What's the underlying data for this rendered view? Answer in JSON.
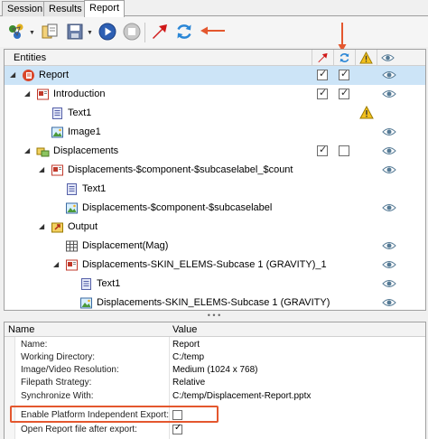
{
  "tabs": [
    {
      "label": "Session",
      "active": false
    },
    {
      "label": "Results",
      "active": false
    },
    {
      "label": "Report",
      "active": true
    }
  ],
  "toolbar": {
    "icons": [
      "add-entities-icon",
      "copy-icon",
      "save-icon",
      "play-icon",
      "stop-icon",
      "export-icon",
      "refresh-icon"
    ]
  },
  "tree": {
    "header": "Entities",
    "columns": [
      "export-icon",
      "refresh-icon",
      "warning-icon",
      "eye-icon"
    ],
    "rows": [
      {
        "label": "Report",
        "icon": "report-icon",
        "col1": true,
        "col2": true,
        "eye": true,
        "selected": true
      },
      {
        "label": "Introduction",
        "icon": "chapter-icon",
        "col1": true,
        "col2": true,
        "eye": true
      },
      {
        "label": "Text1",
        "icon": "text-icon",
        "warning": true
      },
      {
        "label": "Image1",
        "icon": "image-icon",
        "eye": true
      },
      {
        "label": "Displacements",
        "icon": "chapter-group-icon",
        "col1": true,
        "col2": false,
        "eye": true
      },
      {
        "label": "Displacements-$component-$subcaselabel_$count",
        "icon": "chapter-icon",
        "eye": true
      },
      {
        "label": "Text1",
        "icon": "text-icon"
      },
      {
        "label": "Displacements-$component-$subcaselabel",
        "icon": "image-icon",
        "eye": true
      },
      {
        "label": "Output",
        "icon": "output-icon"
      },
      {
        "label": "Displacement(Mag)",
        "icon": "table-icon",
        "eye": true
      },
      {
        "label": "Displacements-SKIN_ELEMS-Subcase 1 (GRAVITY)_1",
        "icon": "chapter-icon",
        "eye": true
      },
      {
        "label": "Text1",
        "icon": "text-icon",
        "eye": true
      },
      {
        "label": "Displacements-SKIN_ELEMS-Subcase 1 (GRAVITY)",
        "icon": "image-icon",
        "eye": true
      }
    ]
  },
  "splitter": "• • •",
  "properties": {
    "name_header": "Name",
    "value_header": "Value",
    "rows": [
      {
        "name": "Name:",
        "value": "Report"
      },
      {
        "name": "Working Directory:",
        "value": "C:/temp"
      },
      {
        "name": "Image/Video Resolution:",
        "value": "Medium (1024 x 768)"
      },
      {
        "name": "Filepath Strategy:",
        "value": "Relative"
      },
      {
        "name": "Synchronize With:",
        "value": "C:/temp/Displacement-Report.pptx"
      },
      {
        "name": "Enable Platform Independent Export:",
        "checkbox": false
      },
      {
        "name": "Open Report file after export:",
        "checkbox": true
      }
    ]
  },
  "colors": {
    "callout": "#e4572e",
    "selection": "#cce4f7"
  }
}
